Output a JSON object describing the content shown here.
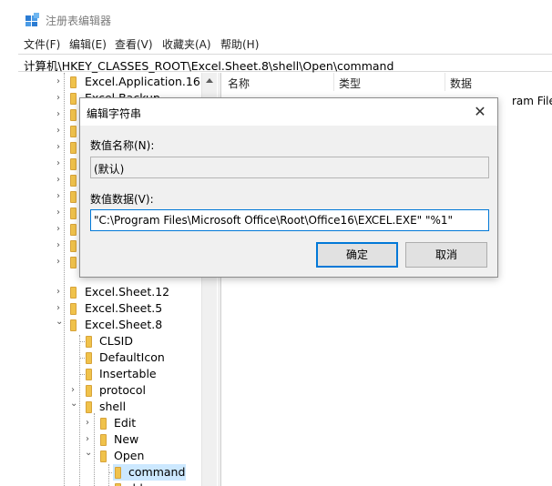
{
  "window": {
    "title": "注册表编辑器",
    "menu": [
      "文件(F)",
      "编辑(E)",
      "查看(V)",
      "收藏夹(A)",
      "帮助(H)"
    ],
    "address": "计算机\\HKEY_CLASSES_ROOT\\Excel.Sheet.8\\shell\\Open\\command"
  },
  "tree": {
    "top_items": [
      "Excel.Application.16",
      "Excel.Backup"
    ],
    "items": [
      "Excel.Sheet.12",
      "Excel.Sheet.5",
      "Excel.Sheet.8",
      "CLSID",
      "DefaultIcon",
      "Insertable",
      "protocol",
      "shell",
      "Edit",
      "New",
      "Open",
      "command",
      "ddeexec"
    ]
  },
  "list": {
    "columns": [
      "名称",
      "类型",
      "数据"
    ],
    "visible_fragment": "ram Files\\M"
  },
  "dialog": {
    "title": "编辑字符串",
    "name_label": "数值名称(N):",
    "name_value": "(默认)",
    "data_label": "数值数据(V):",
    "data_value": "\"C:\\Program Files\\Microsoft Office\\Root\\Office16\\EXCEL.EXE\" \"%1\"",
    "ok_label": "确定",
    "cancel_label": "取消",
    "close_glyph": "✕"
  },
  "icons": {
    "app": "regedit-icon",
    "folder": "folder-icon",
    "chevron_right": "›",
    "chevron_down": "⌄"
  },
  "colors": {
    "folder": "#f0c24b",
    "accent": "#0078d7",
    "selection": "#cce8ff"
  }
}
